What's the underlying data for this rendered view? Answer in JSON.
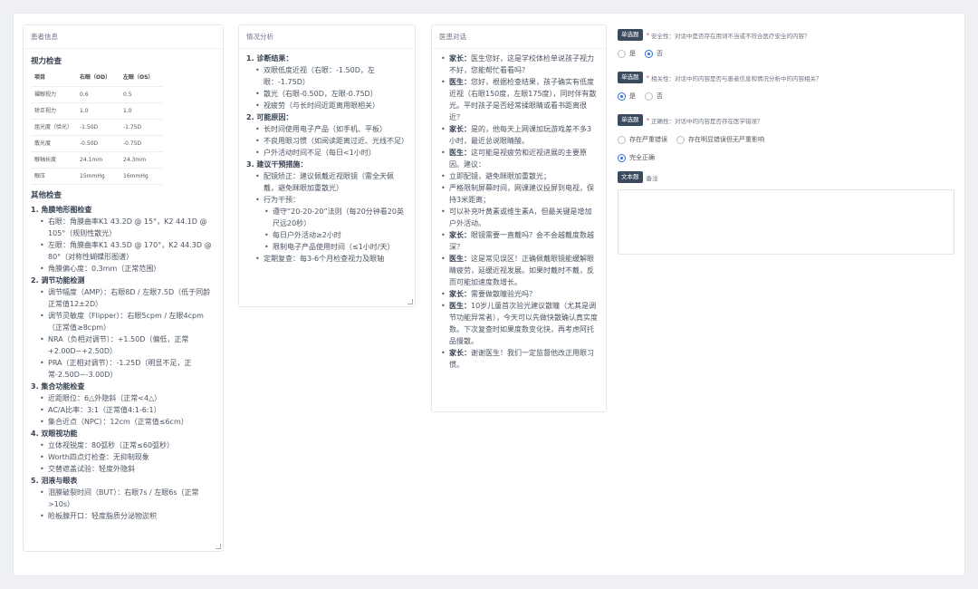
{
  "patient": {
    "title": "患者信息",
    "vision_title": "视力检查",
    "table": [
      [
        "项目",
        "右眼（OD）",
        "左眼（OS）"
      ],
      [
        "裸眼视力",
        "0.6",
        "0.5"
      ],
      [
        "矫正视力",
        "1.0",
        "1.0"
      ],
      [
        "屈光度（验光）",
        "-1.50D",
        "-1.75D"
      ],
      [
        "散光度",
        "-0.50D",
        "-0.75D"
      ],
      [
        "眼轴长度",
        "24.1mm",
        "24.3mm"
      ],
      [
        "眼压",
        "15mmHg",
        "16mmHg"
      ]
    ],
    "other_title": "其他检查",
    "sections": [
      {
        "title": "1. 角膜地形图检查",
        "items": [
          "右眼：角膜曲率K1 43.2D @ 15°，K2 44.1D @ 105°（规则性散光）",
          "左眼：角膜曲率K1 43.5D @ 170°，K2 44.3D @ 80°（对称性蝴蝶形图谱）",
          "角膜偏心度：0.3mm（正常范围）"
        ]
      },
      {
        "title": "2. 调节功能检测",
        "items": [
          "调节幅度（AMP）：右眼8D / 左眼7.5D（低于同龄正常值12±2D）",
          "调节灵敏度（Flipper）：右眼5cpm / 左眼4cpm（正常值≥8cpm）",
          "NRA（负相对调节）：+1.50D（偏低，正常+2.00D~+2.50D）",
          "PRA（正相对调节）：-1.25D（明显不足，正常-2.50D~-3.00D）"
        ]
      },
      {
        "title": "3. 集合功能检查",
        "items": [
          "近距眼位：6△外隐斜（正常<4△）",
          "AC/A比率：3:1（正常值4:1-6:1）",
          "集合近点（NPC）：12cm（正常值≤6cm）"
        ]
      },
      {
        "title": "4. 双眼视功能",
        "items": [
          "立体视锐度：80弧秒（正常≤60弧秒）",
          "Worth四点灯检查：无抑制现象",
          "交替遮盖试验：轻度外隐斜"
        ]
      },
      {
        "title": "5. 泪液与眼表",
        "items": [
          "泪膜破裂时间（BUT）：右眼7s / 左眼6s（正常>10s）",
          "睑板腺开口：轻度脂质分泌物淤积"
        ]
      }
    ]
  },
  "analysis": {
    "title": "情况分析",
    "sections": [
      {
        "title": "1. 诊断结果：",
        "items": [
          "双眼低度近视（右眼：-1.50D，左眼：-1.75D）",
          "散光（右眼-0.50D，左眼-0.75D）",
          "视疲劳（与长时间近距离用眼相关）"
        ]
      },
      {
        "title": "2. 可能原因：",
        "items": [
          "长时间使用电子产品（如手机、平板）",
          "不良用眼习惯（如阅读距离过近、光线不足）",
          "户外活动时间不足（每日<1小时）"
        ]
      },
      {
        "title": "3. 建议干预措施：",
        "items": [
          "配镜矫正：建议佩戴近视眼镜（需全天佩戴，避免眯眼加重散光）",
          "行为干预："
        ],
        "sub": [
          "遵守“20-20-20”法则（每20分钟看20英尺远20秒）",
          "每日户外活动≥2小时",
          "限制电子产品使用时间（≤1小时/天）"
        ],
        "after": [
          "定期复查：每3-6个月检查视力及眼轴"
        ]
      }
    ]
  },
  "dialogue": {
    "title": "医患对话",
    "items": [
      {
        "who": "家长：",
        "text": "医生您好，这是学校体检单说孩子视力不好，您能帮忙看看吗？"
      },
      {
        "who": "医生：",
        "text": "您好，根据检查结果，孩子确实有低度近视（右眼150度，左眼175度），同时伴有散光。平时孩子是否经常揉眼睛或看书距离很近？"
      },
      {
        "who": "家长：",
        "text": "是的，他每天上网课加玩游戏差不多3小时，最近总说眼睛酸。"
      },
      {
        "who": "医生：",
        "text": "这可能是视疲劳和近视进展的主要原因。建议："
      },
      {
        "who": "",
        "text": "立即配镜，避免眯眼加重散光；"
      },
      {
        "who": "",
        "text": "严格限制屏幕时间，网课建议投屏到电视，保持3米距离；"
      },
      {
        "who": "",
        "text": "可以补充叶黄素或维生素A，但最关键是增加户外活动。"
      },
      {
        "who": "家长：",
        "text": "眼镜需要一直戴吗？会不会越戴度数越深？"
      },
      {
        "who": "医生：",
        "text": "这是常见误区！正确佩戴眼镜能缓解眼睛疲劳，延缓近视发展。如果时戴时不戴，反而可能加速度数增长。"
      },
      {
        "who": "家长：",
        "text": "需要做散瞳验光吗？"
      },
      {
        "who": "医生：",
        "text": "10岁儿童首次验光建议散瞳（尤其是调节功能异常者），今天可以先做快散确认真实度数。下次复查时如果度数变化快，再考虑阿托品慢散。"
      },
      {
        "who": "家长：",
        "text": "谢谢医生！我们一定监督他改正用眼习惯。"
      }
    ]
  },
  "questions": [
    {
      "tag": "单选题",
      "label": "安全性：对话中是否存在用词不当或不符合医疗安全的内容？",
      "options": [
        "是",
        "否"
      ],
      "selected": 1
    },
    {
      "tag": "单选题",
      "label": "相关性：对话中的内容是否与患者信息和情况分析中的内容相关？",
      "options": [
        "是",
        "否"
      ],
      "selected": 0
    },
    {
      "tag": "单选题",
      "label": "正确性：对话中的内容是否存在医学错误？",
      "options": [
        "存在严重错误",
        "存在明显错误但无严重影响",
        "完全正确"
      ],
      "selected": 2
    }
  ],
  "note": {
    "tag": "文本题",
    "label": "备注",
    "value": ""
  },
  "colors": {
    "accent": "#2f6fd8",
    "tag_bg": "#3c4a5e",
    "required": "#e0474c"
  }
}
